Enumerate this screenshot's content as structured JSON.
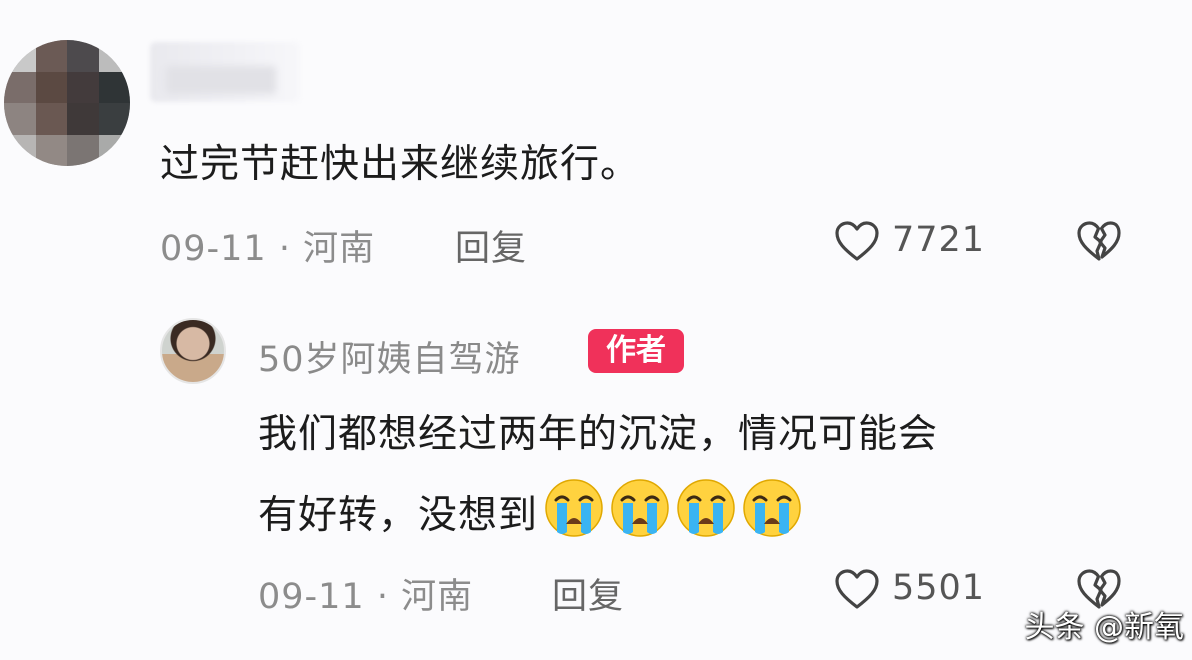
{
  "comment": {
    "text": "过完节赶快出来继续旅行。",
    "date_location": "09-11 · 河南",
    "reply_label": "回复",
    "likes": "7721"
  },
  "reply": {
    "author": "50岁阿姨自驾游",
    "badge": "作者",
    "text_line1": "我们都想经过两年的沉淀，情况可能会",
    "text_line2": "有好转，没想到",
    "emoji": "loudly-crying-face",
    "emoji_count": 4,
    "date_location": "09-11 · 河南",
    "reply_label": "回复",
    "likes": "5501"
  },
  "watermark": "头条 @新氧",
  "colors": {
    "badge": "#f0315a",
    "meta_text": "#8c8c8c",
    "body_text": "#1c1c1c",
    "background": "#fbfbfd"
  }
}
